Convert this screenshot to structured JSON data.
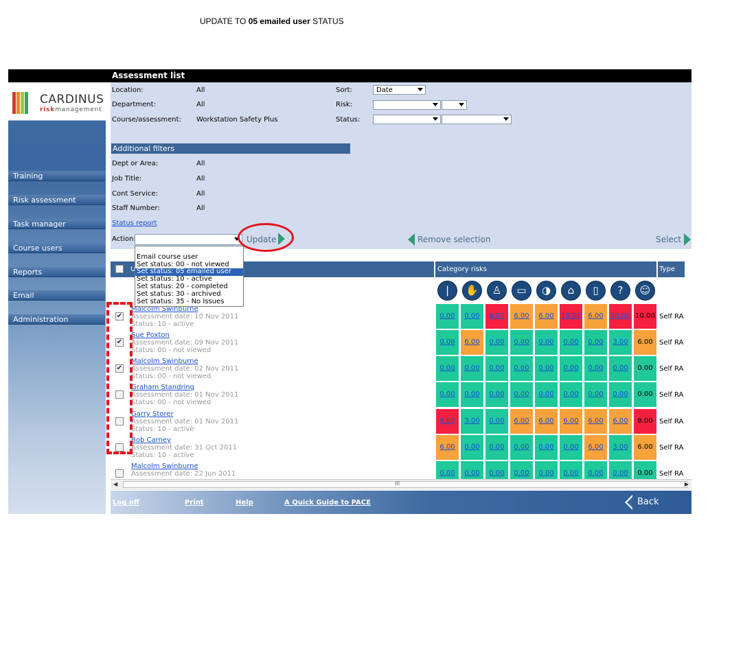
{
  "caption": {
    "prefix": "UPDATE TO ",
    "bold": "05 emailed user",
    "suffix": " STATUS"
  },
  "window": {
    "title": "Assessment list"
  },
  "brand": {
    "name": "CARDINUS",
    "sub_bold": "risk",
    "sub": "management",
    "bar_colors": [
      "#d63a2f",
      "#f28a1e",
      "#a4c63b",
      "#3aa85c"
    ]
  },
  "nav": [
    "Training",
    "Risk assessment",
    "Task manager",
    "Course users",
    "Reports",
    "Email",
    "Administration"
  ],
  "filters": {
    "location_label": "Location:",
    "location_value": "All",
    "department_label": "Department:",
    "department_value": "All",
    "course_label": "Course/assessment:",
    "course_value": "Workstation Safety Plus",
    "sort_label": "Sort:",
    "sort_value": "Date",
    "risk_label": "Risk:",
    "status_label": "Status:"
  },
  "additional": {
    "title": "Additional filters",
    "dept_label": "Dept or Area:",
    "dept_value": "All",
    "job_label": "Job Title:",
    "job_value": "All",
    "cont_label": "Cont Service:",
    "cont_value": "All",
    "staff_label": "Staff Number:",
    "staff_value": "All"
  },
  "status_report": "Status report",
  "action": {
    "label": "Action:",
    "update": "Update",
    "remove": "Remove selection",
    "select": "Select"
  },
  "dropdown": {
    "options": [
      "Email course user",
      "Set status: 00 - not viewed",
      "Set status: 05 emailed user",
      "Set status: 10 - active",
      "Set status: 20 - completed",
      "Set status: 30 - archived",
      "Set status: 35 - No Issues"
    ],
    "highlighted_index": 2
  },
  "table": {
    "col_user": "U",
    "col_risks": "Category risks",
    "col_type": "Type",
    "icons": [
      "spine-icon",
      "hand-icon",
      "chair-icon",
      "monitor-icon",
      "mouse-icon",
      "desk-icon",
      "laptop-icon",
      "question-icon",
      "stretch-icon"
    ],
    "rows": [
      {
        "name": "Malcolm Swinburne",
        "date": "Assessment date: 10 Nov 2011",
        "status": "Status: 10 - active",
        "checked": true,
        "values": [
          "0.00",
          "0.00",
          "8.00",
          "6.00",
          "6.00",
          "10.00",
          "6.00",
          "10.00"
        ],
        "total": "10.00",
        "type": "Self RA"
      },
      {
        "name": "Sue Poxton",
        "date": "Assessment date: 09 Nov 2011",
        "status": "Status: 00 - not viewed",
        "checked": true,
        "values": [
          "0.00",
          "6.00",
          "0.00",
          "0.00",
          "0.00",
          "0.00",
          "0.00",
          "3.00"
        ],
        "total": "6.00",
        "type": "Self RA"
      },
      {
        "name": "Malcolm Swinburne",
        "date": "Assessment date: 02 Nov 2011",
        "status": "Status: 00 - not viewed",
        "checked": true,
        "values": [
          "0.00",
          "0.00",
          "0.00",
          "0.00",
          "0.00",
          "0.00",
          "0.00",
          "0.00"
        ],
        "total": "0.00",
        "type": "Self RA"
      },
      {
        "name": "Graham Standring",
        "date": "Assessment date: 01 Nov 2011",
        "status": "Status: 00 - not viewed",
        "checked": false,
        "values": [
          "0.00",
          "0.00",
          "0.00",
          "0.00",
          "0.00",
          "0.00",
          "0.00",
          "0.00"
        ],
        "total": "0.00",
        "type": "Self RA"
      },
      {
        "name": "Garry Storer",
        "date": "Assessment date: 01 Nov 2011",
        "status": "Status: 10 - active",
        "checked": false,
        "values": [
          "8.00",
          "3.00",
          "0.00",
          "6.00",
          "6.00",
          "6.00",
          "6.00",
          "6.00"
        ],
        "total": "8.00",
        "type": "Self RA"
      },
      {
        "name": "Bob Carney",
        "date": "Assessment date: 31 Oct 2011",
        "status": "Status: 10 - active",
        "checked": false,
        "values": [
          "6.00",
          "0.00",
          "0.00",
          "0.00",
          "0.00",
          "0.00",
          "6.00",
          "3.00"
        ],
        "total": "6.00",
        "type": "Self RA"
      },
      {
        "name": "Malcolm Swinburne",
        "date": "Assessment date: 22 Jun 2011",
        "status": "",
        "checked": false,
        "values": [
          "0.00",
          "0.00",
          "0.00",
          "0.00",
          "0.00",
          "0.00",
          "0.00",
          "0.00"
        ],
        "total": "0.00",
        "type": "Self RA"
      }
    ]
  },
  "risk_colors": {
    "0.00": "#1fc99a",
    "3.00": "#1fc99a",
    "6.00": "#f7a23a",
    "8.00": "#f5203f",
    "10.00": "#f5203f"
  },
  "scroll_grip": "III",
  "footer": {
    "logoff": "Log off",
    "print": "Print",
    "help": "Help",
    "guide": "A Quick Guide to PACE",
    "back": "Back"
  }
}
